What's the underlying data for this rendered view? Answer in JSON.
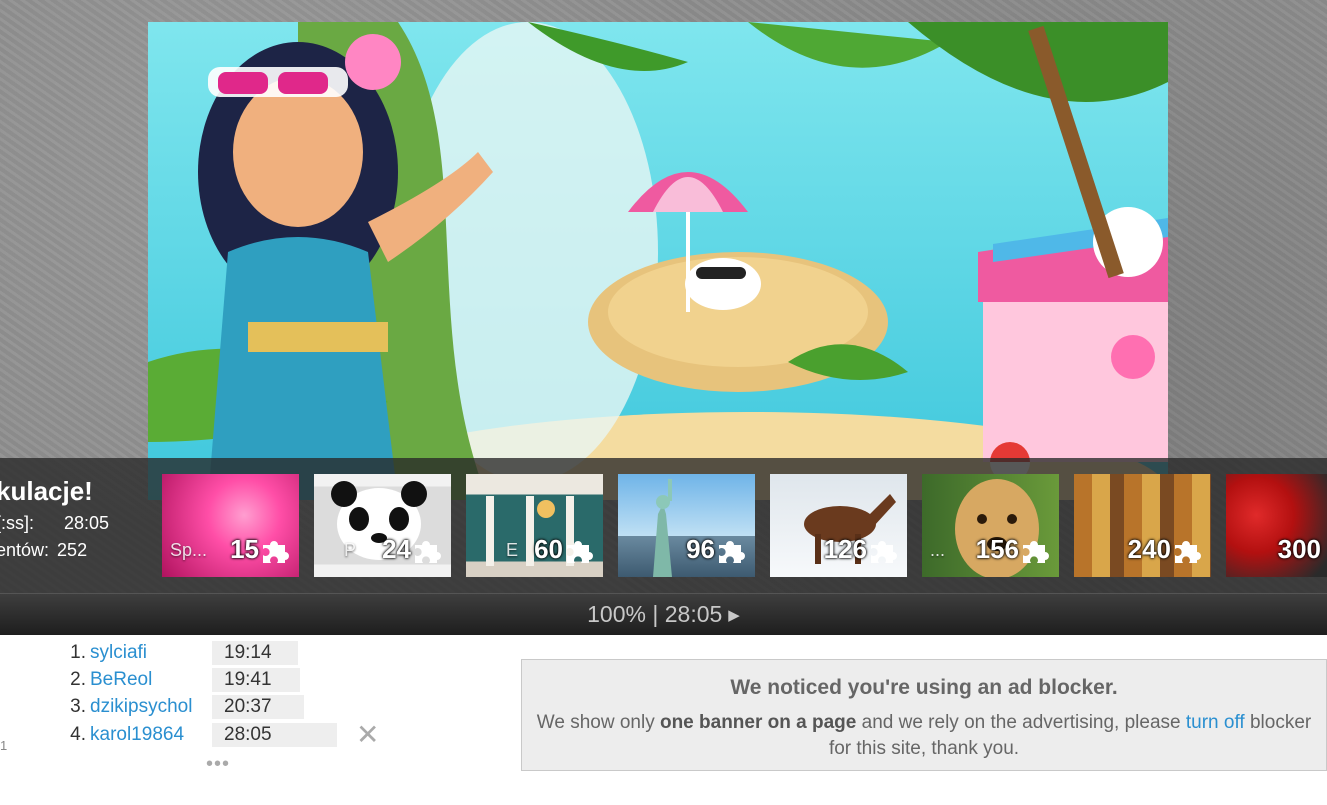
{
  "congrats": {
    "title": "kulacje!",
    "time_label": "[:ss]:",
    "time_value": "28:05",
    "pieces_label": "entów:",
    "pieces_value": "252"
  },
  "thumbnails": [
    {
      "name": "Sp...",
      "count": "15",
      "theme": "pink-flowers"
    },
    {
      "name": "P",
      "count": "24",
      "theme": "panda"
    },
    {
      "name": "E",
      "count": "60",
      "theme": "dancers"
    },
    {
      "name": "",
      "count": "96",
      "theme": "statue-of-liberty"
    },
    {
      "name": "",
      "count": "126",
      "theme": "horse"
    },
    {
      "name": "...",
      "count": "156",
      "theme": "dog"
    },
    {
      "name": "",
      "count": "240",
      "theme": "houses"
    },
    {
      "name": "",
      "count": "300",
      "theme": "helmet"
    }
  ],
  "stats": {
    "progress": "100%",
    "separator": "|",
    "time": "28:05",
    "play_symbol": "▶"
  },
  "leaderboard": [
    {
      "rank": "1.",
      "player": "sylciafi",
      "time": "19:14"
    },
    {
      "rank": "2.",
      "player": "BeReol",
      "time": "19:41"
    },
    {
      "rank": "3.",
      "player": "dzikipsychol",
      "time": "20:37"
    },
    {
      "rank": "4.",
      "player": "karol19864",
      "time": "28:05"
    }
  ],
  "leaderboard_more": "•••",
  "leaderboard_close": "✕",
  "side_number": "1",
  "ad": {
    "title": "We noticed you're using an ad blocker.",
    "text_1": "We show only ",
    "text_bold": "one banner on a page",
    "text_2": " and we rely on the advertising, please ",
    "link": "turn off",
    "text_3": " blocker for this site, thank you."
  }
}
